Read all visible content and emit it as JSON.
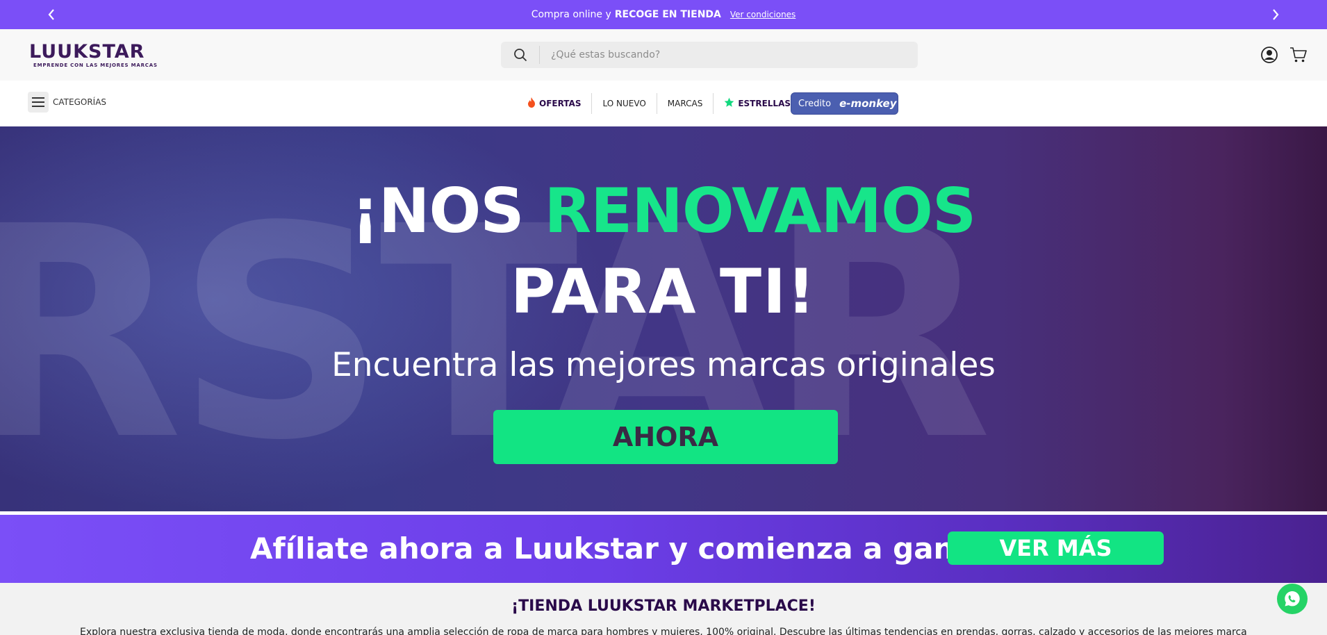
{
  "promo": {
    "text_prefix": "Compra online y",
    "text_strong": "RECOGE EN TIENDA",
    "link": "Ver condiciones"
  },
  "header": {
    "logo": {
      "word": "LUUKSTAR",
      "tagline": "EMPRENDE CON LAS MEJORES MARCAS"
    },
    "search_placeholder": "¿Qué estas buscando?"
  },
  "nav": {
    "categories_label": "CATEGORÍAS",
    "items": [
      {
        "label": "OFERTAS",
        "icon": "fire-icon"
      },
      {
        "label": "LO NUEVO"
      },
      {
        "label": "MARCAS"
      },
      {
        "label": "ESTRELLAS",
        "icon": "star-icon"
      }
    ],
    "credit": {
      "label": "Credito",
      "brand": "e-monkey"
    }
  },
  "hero": {
    "line1_white": "¡NOS",
    "line1_green": "RENOVAMOS",
    "line2": "PARA TI!",
    "subtitle": "Encuentra las mejores marcas originales",
    "cta": "AHORA"
  },
  "affiliate": {
    "text": "Afíliate ahora a Luukstar y comienza a ganar",
    "button": "VER MÁS"
  },
  "marketplace": {
    "title": "¡TIENDA LUUKSTAR MARKETPLACE!",
    "description": "Explora nuestra exclusiva tienda de moda, donde encontrarás una amplia selección de ropa de marca para hombres y mujeres, 100% original. Descubre las últimas tendencias en prendas, gorras, calzado y accesorios de las mejores marcas"
  },
  "colors": {
    "promo_bg": "#7b4ff7",
    "accent_green": "#12e483",
    "brand_dark": "#2a0a4a",
    "credit_bg": "#4b5fb0",
    "whatsapp": "#25d366"
  }
}
